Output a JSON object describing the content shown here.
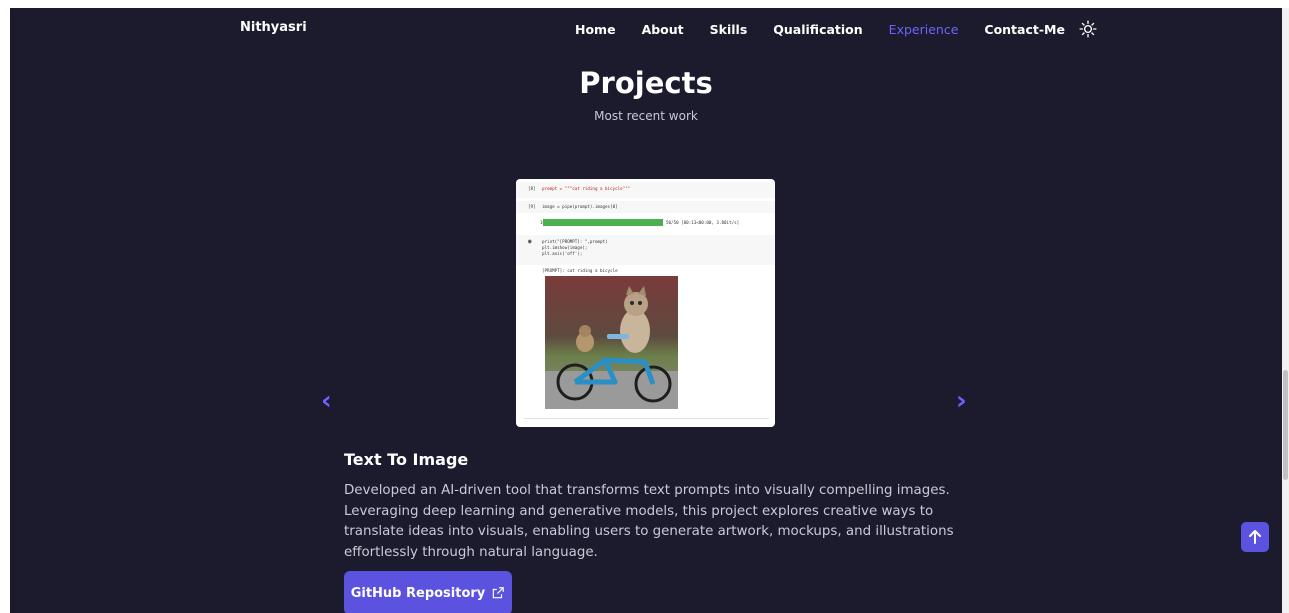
{
  "header": {
    "brand": "Nithyasri",
    "nav": [
      "Home",
      "About",
      "Skills",
      "Qualification",
      "Experience",
      "Contact-Me"
    ],
    "active_nav": "Experience",
    "theme_icon": "sun-icon"
  },
  "section": {
    "title": "Projects",
    "subtitle": "Most recent work"
  },
  "carousel": {
    "prev_icon": "chevron-left-icon",
    "next_icon": "chevron-right-icon",
    "notebook": {
      "cell1_count": "[8]",
      "cell1_code": "prompt = \"\"\"cat riding a bicycle\"\"\"",
      "cell2_count": "[9]",
      "cell2_code": "image = pipe(prompt).images[0]",
      "progress_percent": "100%",
      "progress_fraction": 1.0,
      "progress_stats": "50/50 [00:13<00:00,  3.80it/s]",
      "cell3_code_lines": [
        "print(\"[PROMPT]: \",prompt)",
        "plt.imshow(image);",
        "plt.axis('off');"
      ],
      "output_text": "[PROMPT]:  cat riding a bicycle"
    }
  },
  "project": {
    "title": "Text To Image",
    "description": "Developed an AI-driven tool that transforms text prompts into visually compelling images. Leveraging deep learning and generative models, this project explores creative ways to translate ideas into visuals, enabling users to generate artwork, mockups, and illustrations effortlessly through natural language.",
    "button_label": "GitHub Repository",
    "button_icon": "external-link-icon"
  },
  "scroll_top_icon": "arrow-up-icon",
  "colors": {
    "background": "#1c1b2d",
    "accent": "#6c63ff",
    "button": "#5c52e0",
    "text": "#ffffff",
    "muted_text": "#c9c9d6"
  }
}
